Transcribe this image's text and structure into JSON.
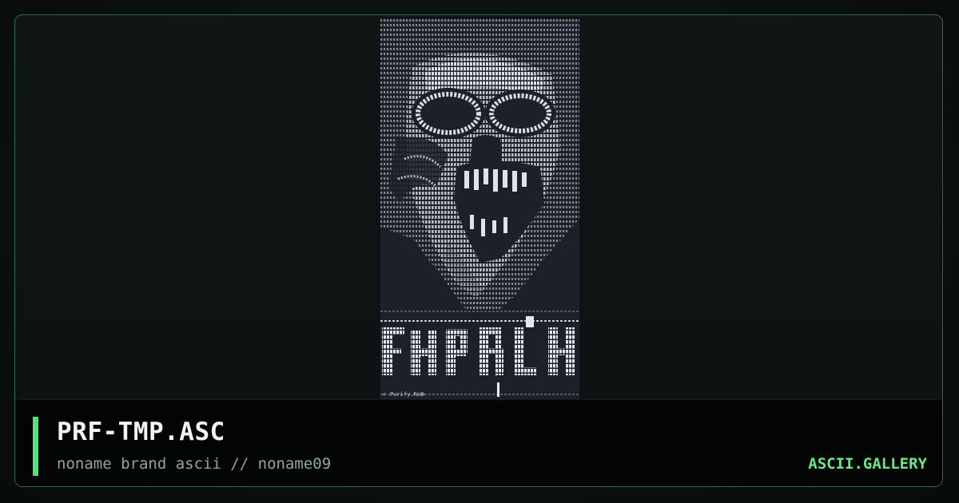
{
  "card": {
    "title": "PRF-TMP.ASC",
    "subtitle": "noname brand ascii // noname09",
    "site": "ASCII.GALLERY"
  },
  "artwork": {
    "footer_text": "Purify.Ro8"
  },
  "colors": {
    "accent": "#57e07a",
    "frame_border": "#2f6a3a",
    "site_label": "#6ee58a",
    "art_background": "#1c2029"
  }
}
